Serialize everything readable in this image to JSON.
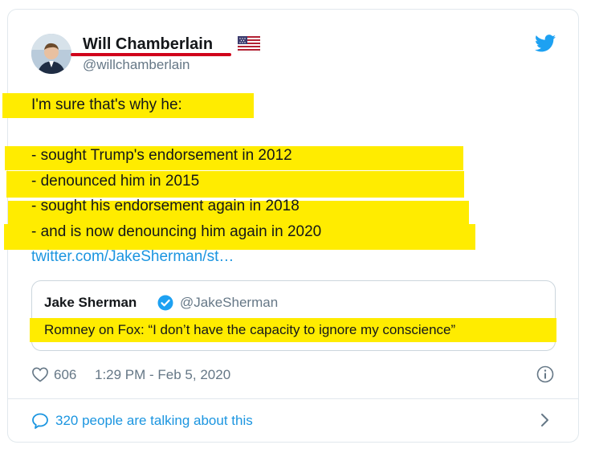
{
  "author": {
    "name": "Will Chamberlain",
    "handle": "@willchamberlain",
    "flag_icon": "us-flag-icon"
  },
  "tweet": {
    "lines": [
      "I'm sure that's why he:",
      "- sought Trump's endorsement in 2012",
      "- denounced him in 2015",
      "- sought his endorsement again in 2018",
      "- and is now denouncing him again in 2020"
    ],
    "link": "twitter.com/JakeSherman/st…",
    "highlight_color": "#ffec00"
  },
  "quoted_tweet": {
    "name": "Jake Sherman",
    "handle": "@JakeSherman",
    "text": "Romney on Fox: “I don’t have the capacity to ignore my conscience”"
  },
  "footer": {
    "likes": "606",
    "timestamp": "1:29 PM - Feb 5, 2020",
    "talking": "320 people are talking about this"
  },
  "colors": {
    "brand_blue": "#1da1f2",
    "link_blue": "#1b95e0",
    "underline_red": "#d0021b"
  }
}
